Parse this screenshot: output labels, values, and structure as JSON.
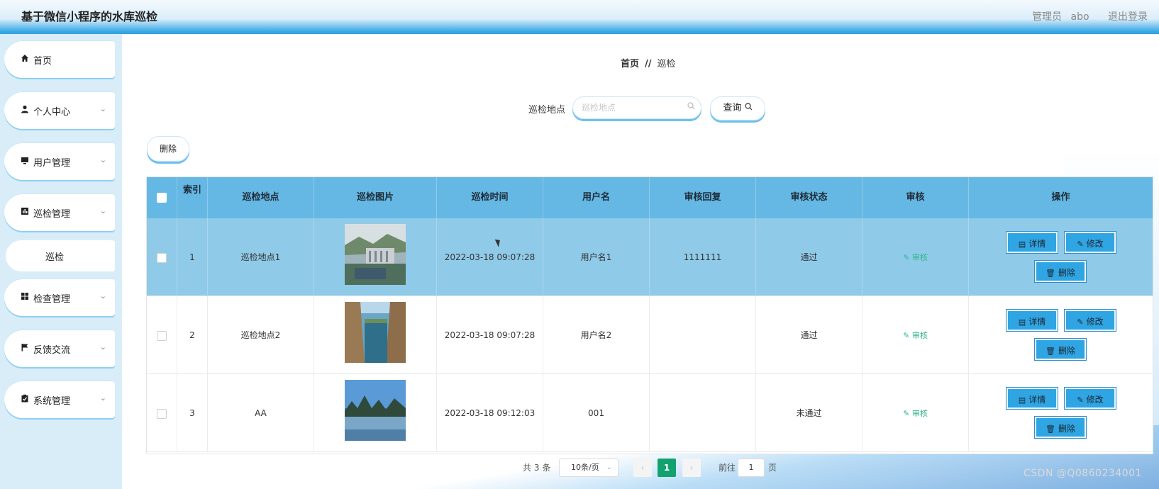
{
  "header": {
    "app_title": "基于微信小程序的水库巡检",
    "role": "管理员",
    "username": "abo",
    "logout": "退出登录"
  },
  "sidebar": {
    "items": [
      {
        "label": "首页",
        "icon": "home-icon"
      },
      {
        "label": "个人中心",
        "icon": "user-icon"
      },
      {
        "label": "用户管理",
        "icon": "monitor-icon"
      },
      {
        "label": "巡检管理",
        "icon": "chart-icon"
      },
      {
        "label": "检查管理",
        "icon": "grid-icon"
      },
      {
        "label": "反馈交流",
        "icon": "flag-icon"
      },
      {
        "label": "系统管理",
        "icon": "clipboard-icon"
      }
    ],
    "sub_item": "巡检"
  },
  "breadcrumb": {
    "home": "首页",
    "separator": "//",
    "current": "巡检"
  },
  "search": {
    "label": "巡检地点",
    "placeholder": "巡检地点",
    "button": "查询"
  },
  "toolbar": {
    "delete": "删除"
  },
  "table": {
    "headers": {
      "index": "索引",
      "location": "巡检地点",
      "image": "巡检图片",
      "time": "巡检时间",
      "username": "用户名",
      "reply": "审核回复",
      "status": "审核状态",
      "audit": "审核",
      "ops": "操作"
    },
    "rows": [
      {
        "index": "1",
        "location": "巡检地点1",
        "time": "2022-03-18 09:07:28",
        "username": "用户名1",
        "reply": "1111111",
        "status": "通过",
        "audit": "审核"
      },
      {
        "index": "2",
        "location": "巡检地点2",
        "time": "2022-03-18 09:07:28",
        "username": "用户名2",
        "reply": "",
        "status": "通过",
        "audit": "审核"
      },
      {
        "index": "3",
        "location": "AA",
        "time": "2022-03-18 09:12:03",
        "username": "001",
        "reply": "",
        "status": "未通过",
        "audit": "审核"
      }
    ],
    "actions": {
      "detail": "详情",
      "edit": "修改",
      "delete": "删除"
    }
  },
  "pagination": {
    "total_prefix": "共",
    "total": "3",
    "total_suffix": "条",
    "page_size": "10条/页",
    "current_page": "1",
    "goto_prefix": "前往",
    "goto_value": "1",
    "goto_suffix": "页"
  },
  "watermark": "CSDN @Q0860234001",
  "colors": {
    "header_blue": "#2f9fe0",
    "table_head": "#65b8e4",
    "row_highlight": "#8fcbe9",
    "action_button": "#2fa5e4",
    "audit_green": "#2fb58c",
    "page_active": "#13a26f"
  }
}
